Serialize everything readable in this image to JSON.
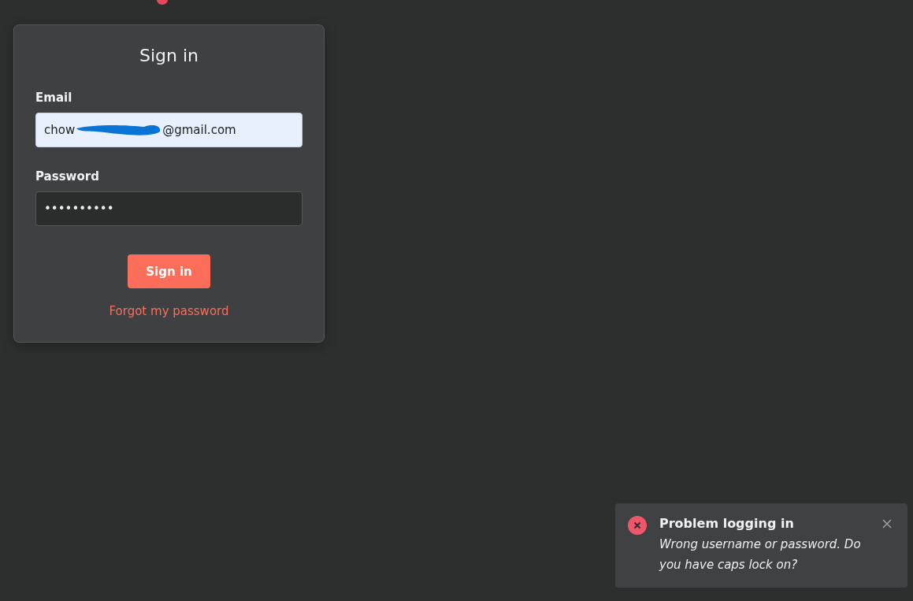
{
  "card": {
    "title": "Sign in",
    "email": {
      "label": "Email",
      "value_start": "chow",
      "value_end": "@gmail.com",
      "redacted": true
    },
    "password": {
      "label": "Password",
      "value": "••••••••••"
    },
    "submit": "Sign in",
    "forgot_link": "Forgot my password"
  },
  "toast": {
    "title": "Problem logging in",
    "message": "Wrong username or password. Do you have caps lock on?"
  }
}
